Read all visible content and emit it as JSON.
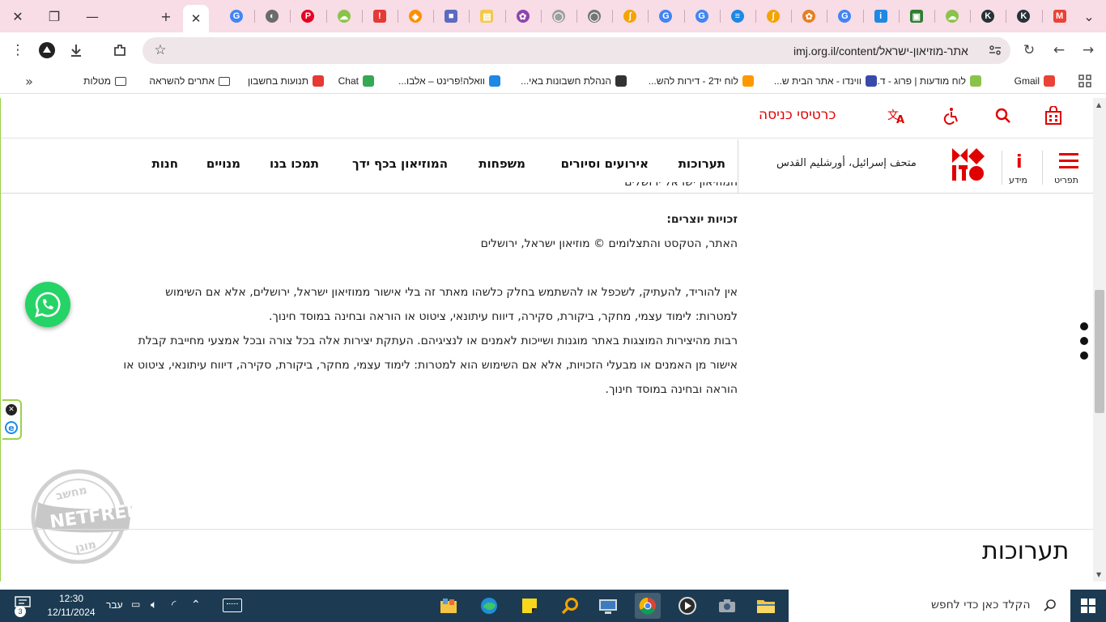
{
  "browser": {
    "active_tab_close": "✕",
    "new_tab": "+",
    "url": "imj.org.il/content/אתר-מוזיאון-ישראל",
    "tab_favicons": [
      {
        "letter": "G",
        "color": "#4285f4",
        "shape": "circle"
      },
      {
        "letter": "◐",
        "color": "#6b6b6b",
        "shape": "circle"
      },
      {
        "letter": "P",
        "color": "#e60023",
        "shape": "circle"
      },
      {
        "letter": "☁",
        "color": "#8bc34a",
        "shape": "circle"
      },
      {
        "letter": "!",
        "color": "#e53935",
        "shape": "sq"
      },
      {
        "letter": "◆",
        "color": "#ff8f00",
        "shape": "circle"
      },
      {
        "letter": "■",
        "color": "#5c6bc0",
        "shape": "sq"
      },
      {
        "letter": "▤",
        "color": "#f2c94c",
        "shape": "sq"
      },
      {
        "letter": "✿",
        "color": "#8e44ad",
        "shape": "circle"
      },
      {
        "letter": "◯",
        "color": "#9e9e9e",
        "shape": "circle"
      },
      {
        "letter": "◯",
        "color": "#757575",
        "shape": "circle"
      },
      {
        "letter": "ʃ",
        "color": "#f4a300",
        "shape": "circle"
      },
      {
        "letter": "G",
        "color": "#4285f4",
        "shape": "circle"
      },
      {
        "letter": "G",
        "color": "#4285f4",
        "shape": "circle"
      },
      {
        "letter": "≡",
        "color": "#1e88e5",
        "shape": "circle"
      },
      {
        "letter": "ʃ",
        "color": "#f4a300",
        "shape": "circle"
      },
      {
        "letter": "✿",
        "color": "#e67e22",
        "shape": "circle"
      },
      {
        "letter": "G",
        "color": "#4285f4",
        "shape": "circle"
      },
      {
        "letter": "i",
        "color": "#1e88e5",
        "shape": "sq"
      },
      {
        "letter": "▣",
        "color": "#2e7d32",
        "shape": "sq"
      },
      {
        "letter": "☁",
        "color": "#8bc34a",
        "shape": "circle"
      },
      {
        "letter": "K",
        "color": "#263238",
        "shape": "circle"
      },
      {
        "letter": "K",
        "color": "#263238",
        "shape": "circle"
      },
      {
        "letter": "M",
        "color": "#ea4335",
        "shape": "sq"
      }
    ]
  },
  "bookmarks": [
    {
      "label": "Gmail",
      "color": "#ea4335"
    },
    {
      "label": "לוח מודעות | פרוג - ד...",
      "color": "#8bc34a"
    },
    {
      "label": "ווינדו - אתר הבית ש...",
      "color": "#3949ab"
    },
    {
      "label": "לוח יד2 - דירות להש...",
      "color": "#ff9800"
    },
    {
      "label": "הנהלת חשבונות באי...",
      "color": "#333333"
    },
    {
      "label": "וואלה!פרינט – אלבו...",
      "color": "#1e88e5"
    },
    {
      "label": "Chat",
      "color": "#34a853"
    },
    {
      "label": "תנועות בחשבון",
      "color": "#e53935"
    },
    {
      "label": "אתרים להשראה",
      "folder": true
    },
    {
      "label": "מטלות",
      "folder": true
    }
  ],
  "site": {
    "tickets": "כרטיסי כניסה",
    "menu_label": "תפריט",
    "info_label": "מידע",
    "arabic_name": "متحف إسرائيل، أورشليم القدس",
    "nav": [
      "תערוכות",
      "אירועים וסיורים",
      "משפחות",
      "המוזיאון בכף ידך",
      "תמכו בנו",
      "מנויים",
      "חנות"
    ],
    "cut_text": "המוזיאון ישראל ירושלים",
    "copyright_heading": "זכויות יוצרים:",
    "copyright_line": "האתר, הטקסט והתצלומים © מוזיאון ישראל, ירושלים",
    "para1": "אין להוריד, להעתיק, לשכפל או להשתמש בחלק כלשהו מאתר זה בלי אישור ממוזיאון ישראל, ירושלים, אלא אם השימוש למטרות: לימוד עצמי, מחקר, ביקורת, סקירה, דיווח עיתונאי, ציטוט או הוראה ובחינה במוסד חינוך.",
    "para2": "רבות מהיצירות המוצגות באתר מוגנות ושייכות לאמנים או לנציגיהם. העתקת יצירות אלה בכל צורה ובכל אמצעי מחייבת קבלת אישור מן האמנים או מבעלי הזכויות, אלא אם השימוש הוא למטרות: לימוד עצמי, מחקר, ביקורת, סקירה, דיווח עיתונאי, ציטוט או הוראה ובחינה במוסד חינוך.",
    "section_title": "תערוכות"
  },
  "netfree": {
    "top": "מחשב",
    "mid": "NETFREE",
    "bottom": "מוגן"
  },
  "taskbar": {
    "search_placeholder": "הקלד כאן כדי לחפש",
    "time": "12:30",
    "date": "12/11/2024",
    "lang": "עבר",
    "notif_count": "3"
  },
  "colors": {
    "brand_red": "#e00000",
    "taskbar": "#1c3b52",
    "tab_strip": "#f8dce6"
  }
}
